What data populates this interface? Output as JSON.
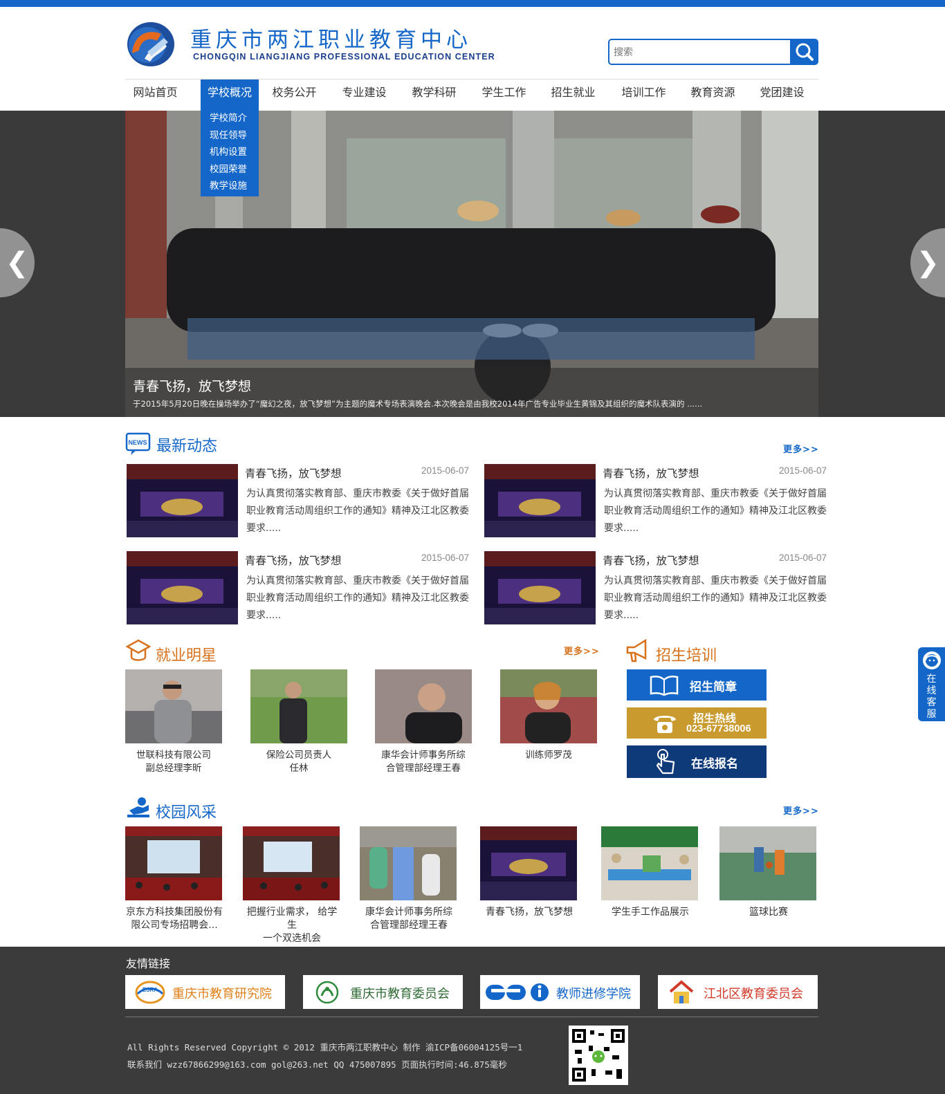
{
  "header": {
    "logo_cn": "重庆市两江职业教育中心",
    "logo_en": "CHONGQIN LIANGJIANG PROFESSIONAL EDUCATION CENTER",
    "search_placeholder": "搜索"
  },
  "nav": {
    "items": [
      "网站首页",
      "学校概况",
      "校务公开",
      "专业建设",
      "教学科研",
      "学生工作",
      "招生就业",
      "培训工作",
      "教育资源",
      "党团建设"
    ],
    "active": "学校概况",
    "dropdown": [
      "学校简介",
      "现任领导",
      "机构设置",
      "校园荣誉",
      "教学设施"
    ]
  },
  "banner": {
    "title": "青春飞扬，放飞梦想",
    "desc": "于2015年5月20日晚在操场举办了“魔幻之夜，放飞梦想”为主题的魔术专场表演晚会.本次晚会是由我校2014年广告专业毕业生黄锦及其组织的魔术队表演的 ......",
    "prev": "❮",
    "next": "❯"
  },
  "news": {
    "title": "最新动态",
    "more": "更多>>",
    "items": [
      {
        "title": "青春飞扬，放飞梦想",
        "date": "2015-06-07",
        "text": "为认真贯彻落实教育部、重庆市教委《关于做好首届职业教育活动周组织工作的通知》精神及江北区教委要求....."
      },
      {
        "title": "青春飞扬，放飞梦想",
        "date": "2015-06-07",
        "text": "为认真贯彻落实教育部、重庆市教委《关于做好首届职业教育活动周组织工作的通知》精神及江北区教委要求....."
      },
      {
        "title": "青春飞扬，放飞梦想",
        "date": "2015-06-07",
        "text": "为认真贯彻落实教育部、重庆市教委《关于做好首届职业教育活动周组织工作的通知》精神及江北区教委要求....."
      },
      {
        "title": "青春飞扬，放飞梦想",
        "date": "2015-06-07",
        "text": "为认真贯彻落实教育部、重庆市教委《关于做好首届职业教育活动周组织工作的通知》精神及江北区教委要求....."
      }
    ]
  },
  "stars": {
    "title": "就业明星",
    "more": "更多>>",
    "items": [
      {
        "line1": "世联科技有限公司",
        "line2": "副总经理李昕"
      },
      {
        "line1": "保险公司员责人",
        "line2": "任林"
      },
      {
        "line1": "康华会计师事务所综",
        "line2": "合管理部经理王春"
      },
      {
        "line1": "训练师罗茂",
        "line2": ""
      }
    ]
  },
  "enroll": {
    "title": "招生培训",
    "guide": "招生简章",
    "hotline_label": "招生热线",
    "hotline_number": "023-67738006",
    "online": "在线报名"
  },
  "campus": {
    "title": "校园风采",
    "more": "更多>>",
    "items": [
      {
        "line1": "京东方科技集团股份有",
        "line2": "限公司专场招聘会..."
      },
      {
        "line1": "把握行业需求， 给学生",
        "line2": "一个双选机会"
      },
      {
        "line1": "康华会计师事务所综",
        "line2": "合管理部经理王春"
      },
      {
        "line1": "青春飞扬，放飞梦想",
        "line2": ""
      },
      {
        "line1": "学生手工作品展示",
        "line2": ""
      },
      {
        "line1": "篮球比赛",
        "line2": ""
      }
    ]
  },
  "footer": {
    "links_title": "友情链接",
    "links": [
      "重庆市教育研究院",
      "重庆市教育委员会",
      "教师进修学院",
      "江北区教育委员会"
    ],
    "copyright": "All Rights Reserved Copyright © 2012 重庆市两江职教中心 制作 渝ICP备06004125号一1",
    "contact": "联系我们 wzz67866299@163.com gol@263.net  QQ 475007895 页面执行时间:46.875毫秒"
  },
  "kefu": {
    "label": "在线客服"
  },
  "colors": {
    "primary": "#1467c9",
    "orange": "#d7711b",
    "gold": "#c99a2e",
    "navy": "#0e3a7a",
    "footer": "#3b3b3b"
  }
}
